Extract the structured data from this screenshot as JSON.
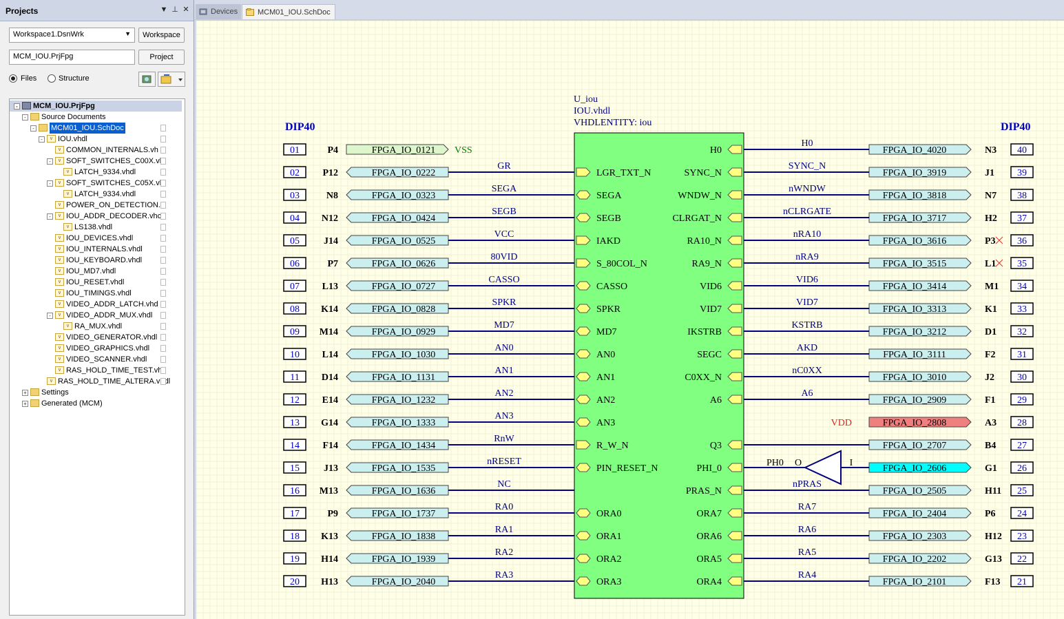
{
  "panel": {
    "title": "Projects",
    "workspace_combo": "Workspace1.DsnWrk",
    "workspace_button": "Workspace",
    "project_field": "MCM_IOU.PrjFpg",
    "project_button": "Project",
    "radio_files": "Files",
    "radio_structure": "Structure",
    "selected_view": "Files"
  },
  "tree": [
    {
      "label": "MCM_IOU.PrjFpg",
      "level": 0,
      "icon": "project",
      "expand": "-",
      "bold": true
    },
    {
      "label": "Source Documents",
      "level": 1,
      "icon": "folder",
      "expand": "-"
    },
    {
      "label": "MCM01_IOU.SchDoc",
      "level": 2,
      "icon": "folder",
      "expand": "-",
      "selected": true,
      "doc": true
    },
    {
      "label": "IOU.vhdl",
      "level": 3,
      "icon": "vhdl",
      "expand": "-",
      "doc": true
    },
    {
      "label": "COMMON_INTERNALS.vh",
      "level": 4,
      "icon": "vhdl",
      "doc": true
    },
    {
      "label": "SOFT_SWITCHES_C00X.vh",
      "level": 4,
      "icon": "vhdl",
      "expand": "-",
      "doc": true
    },
    {
      "label": "LATCH_9334.vhdl",
      "level": 5,
      "icon": "vhdl",
      "doc": true
    },
    {
      "label": "SOFT_SWITCHES_C05X.vh",
      "level": 4,
      "icon": "vhdl",
      "expand": "-",
      "doc": true
    },
    {
      "label": "LATCH_9334.vhdl",
      "level": 5,
      "icon": "vhdl",
      "doc": true
    },
    {
      "label": "POWER_ON_DETECTION.",
      "level": 4,
      "icon": "vhdl",
      "doc": true
    },
    {
      "label": "IOU_ADDR_DECODER.vhc",
      "level": 4,
      "icon": "vhdl",
      "expand": "-",
      "doc": true
    },
    {
      "label": "LS138.vhdl",
      "level": 5,
      "icon": "vhdl",
      "doc": true
    },
    {
      "label": "IOU_DEVICES.vhdl",
      "level": 4,
      "icon": "vhdl",
      "doc": true
    },
    {
      "label": "IOU_INTERNALS.vhdl",
      "level": 4,
      "icon": "vhdl",
      "doc": true
    },
    {
      "label": "IOU_KEYBOARD.vhdl",
      "level": 4,
      "icon": "vhdl",
      "doc": true
    },
    {
      "label": "IOU_MD7.vhdl",
      "level": 4,
      "icon": "vhdl",
      "doc": true
    },
    {
      "label": "IOU_RESET.vhdl",
      "level": 4,
      "icon": "vhdl",
      "doc": true
    },
    {
      "label": "IOU_TIMINGS.vhdl",
      "level": 4,
      "icon": "vhdl",
      "doc": true
    },
    {
      "label": "VIDEO_ADDR_LATCH.vhd",
      "level": 4,
      "icon": "vhdl",
      "doc": true
    },
    {
      "label": "VIDEO_ADDR_MUX.vhdl",
      "level": 4,
      "icon": "vhdl",
      "expand": "-",
      "doc": true
    },
    {
      "label": "RA_MUX.vhdl",
      "level": 5,
      "icon": "vhdl",
      "doc": true
    },
    {
      "label": "VIDEO_GENERATOR.vhdl",
      "level": 4,
      "icon": "vhdl",
      "doc": true
    },
    {
      "label": "VIDEO_GRAPHICS.vhdl",
      "level": 4,
      "icon": "vhdl",
      "doc": true
    },
    {
      "label": "VIDEO_SCANNER.vhdl",
      "level": 4,
      "icon": "vhdl",
      "doc": true
    },
    {
      "label": "RAS_HOLD_TIME_TEST.vh",
      "level": 4,
      "icon": "vhdl",
      "doc": true
    },
    {
      "label": "RAS_HOLD_TIME_ALTERA.vhdl",
      "level": 3,
      "icon": "vhdl",
      "doc": true
    },
    {
      "label": "Settings",
      "level": 1,
      "icon": "folder",
      "expand": "+"
    },
    {
      "label": "Generated (MCM)",
      "level": 1,
      "icon": "folder",
      "expand": "+"
    }
  ],
  "tabs": [
    {
      "label": "Devices",
      "active": false
    },
    {
      "label": "MCM01_IOU.SchDoc",
      "active": true
    }
  ],
  "schematic": {
    "component": {
      "designator": "U_iou",
      "file": "IOU.vhdl",
      "entity": "VHDLENTITY: iou"
    },
    "left_header": "DIP40",
    "right_header": "DIP40",
    "vss_label": "VSS",
    "vdd_label": "VDD",
    "buffer_in": "I",
    "buffer_out": "O",
    "colors": {
      "body": "#80ff80",
      "port": "#cbeeee",
      "port_cyan": "#00ffff",
      "port_vdd": "#f08080",
      "port_vss": "#ddf6cc",
      "wire": "#000080",
      "header": "#0000c0",
      "netlabel": "#000080",
      "pin_fill": "#ffff80"
    },
    "left_rows": [
      {
        "num": "01",
        "pin": "P4",
        "port": "FPGA_IO_0121",
        "net": "",
        "comp_pin": "",
        "dir": "out"
      },
      {
        "num": "02",
        "pin": "P12",
        "port": "FPGA_IO_0222",
        "net": "GR",
        "comp_pin": "LGR_TXT_N",
        "dir": "in"
      },
      {
        "num": "03",
        "pin": "N8",
        "port": "FPGA_IO_0323",
        "net": "SEGA",
        "comp_pin": "SEGA",
        "dir": "bi"
      },
      {
        "num": "04",
        "pin": "N12",
        "port": "FPGA_IO_0424",
        "net": "SEGB",
        "comp_pin": "SEGB",
        "dir": "bi"
      },
      {
        "num": "05",
        "pin": "J14",
        "port": "FPGA_IO_0525",
        "net": "VCC",
        "comp_pin": "IAKD",
        "dir": "in"
      },
      {
        "num": "06",
        "pin": "P7",
        "port": "FPGA_IO_0626",
        "net": "80VID",
        "comp_pin": "S_80COL_N",
        "dir": "in"
      },
      {
        "num": "07",
        "pin": "L13",
        "port": "FPGA_IO_0727",
        "net": "CASSO",
        "comp_pin": "CASSO",
        "dir": "bi"
      },
      {
        "num": "08",
        "pin": "K14",
        "port": "FPGA_IO_0828",
        "net": "SPKR",
        "comp_pin": "SPKR",
        "dir": "bi"
      },
      {
        "num": "09",
        "pin": "M14",
        "port": "FPGA_IO_0929",
        "net": "MD7",
        "comp_pin": "MD7",
        "dir": "bi"
      },
      {
        "num": "10",
        "pin": "L14",
        "port": "FPGA_IO_1030",
        "net": "AN0",
        "comp_pin": "AN0",
        "dir": "bi"
      },
      {
        "num": "11",
        "pin": "D14",
        "port": "FPGA_IO_1131",
        "net": "AN1",
        "comp_pin": "AN1",
        "dir": "bi"
      },
      {
        "num": "12",
        "pin": "E14",
        "port": "FPGA_IO_1232",
        "net": "AN2",
        "comp_pin": "AN2",
        "dir": "bi"
      },
      {
        "num": "13",
        "pin": "G14",
        "port": "FPGA_IO_1333",
        "net": "AN3",
        "comp_pin": "AN3",
        "dir": "bi"
      },
      {
        "num": "14",
        "pin": "F14",
        "port": "FPGA_IO_1434",
        "net": "RnW",
        "comp_pin": "R_W_N",
        "dir": "in"
      },
      {
        "num": "15",
        "pin": "J13",
        "port": "FPGA_IO_1535",
        "net": "nRESET",
        "comp_pin": "PIN_RESET_N",
        "dir": "io"
      },
      {
        "num": "16",
        "pin": "M13",
        "port": "FPGA_IO_1636",
        "net": "NC",
        "comp_pin": "",
        "dir": "none"
      },
      {
        "num": "17",
        "pin": "P9",
        "port": "FPGA_IO_1737",
        "net": "RA0",
        "comp_pin": "ORA0",
        "dir": "bi"
      },
      {
        "num": "18",
        "pin": "K13",
        "port": "FPGA_IO_1838",
        "net": "RA1",
        "comp_pin": "ORA1",
        "dir": "bi"
      },
      {
        "num": "19",
        "pin": "H14",
        "port": "FPGA_IO_1939",
        "net": "RA2",
        "comp_pin": "ORA2",
        "dir": "bi"
      },
      {
        "num": "20",
        "pin": "H13",
        "port": "FPGA_IO_2040",
        "net": "RA3",
        "comp_pin": "ORA3",
        "dir": "bi"
      }
    ],
    "right_rows": [
      {
        "num": "40",
        "pin": "N3",
        "port": "FPGA_IO_4020",
        "net": "H0",
        "comp_pin": "H0",
        "dir": "out",
        "nc": false
      },
      {
        "num": "39",
        "pin": "J1",
        "port": "FPGA_IO_3919",
        "net": "SYNC_N",
        "comp_pin": "SYNC_N",
        "dir": "out",
        "nc": false
      },
      {
        "num": "38",
        "pin": "N7",
        "port": "FPGA_IO_3818",
        "net": "nWNDW",
        "comp_pin": "WNDW_N",
        "dir": "out",
        "nc": false
      },
      {
        "num": "37",
        "pin": "H2",
        "port": "FPGA_IO_3717",
        "net": "nCLRGATE",
        "comp_pin": "CLRGAT_N",
        "dir": "out",
        "nc": false
      },
      {
        "num": "36",
        "pin": "P3",
        "port": "FPGA_IO_3616",
        "net": "nRA10",
        "comp_pin": "RA10_N",
        "dir": "out",
        "nc": true
      },
      {
        "num": "35",
        "pin": "L1",
        "port": "FPGA_IO_3515",
        "net": "nRA9",
        "comp_pin": "RA9_N",
        "dir": "out",
        "nc": true
      },
      {
        "num": "34",
        "pin": "M1",
        "port": "FPGA_IO_3414",
        "net": "VID6",
        "comp_pin": "VID6",
        "dir": "out",
        "nc": false
      },
      {
        "num": "33",
        "pin": "K1",
        "port": "FPGA_IO_3313",
        "net": "VID7",
        "comp_pin": "VID7",
        "dir": "out",
        "nc": false
      },
      {
        "num": "32",
        "pin": "D1",
        "port": "FPGA_IO_3212",
        "net": "KSTRB",
        "comp_pin": "IKSTRB",
        "dir": "out",
        "nc": false
      },
      {
        "num": "31",
        "pin": "F2",
        "port": "FPGA_IO_3111",
        "net": "AKD",
        "comp_pin": "SEGC",
        "dir": "out",
        "nc": false
      },
      {
        "num": "30",
        "pin": "J2",
        "port": "FPGA_IO_3010",
        "net": "nC0XX",
        "comp_pin": "C0XX_N",
        "dir": "out",
        "nc": false
      },
      {
        "num": "29",
        "pin": "F1",
        "port": "FPGA_IO_2909",
        "net": "A6",
        "comp_pin": "A6",
        "dir": "out",
        "nc": false
      },
      {
        "num": "28",
        "pin": "A3",
        "port": "FPGA_IO_2808",
        "net": "",
        "comp_pin": "",
        "dir": "vdd",
        "nc": false
      },
      {
        "num": "27",
        "pin": "B4",
        "port": "FPGA_IO_2707",
        "net": "",
        "comp_pin": "Q3",
        "dir": "out",
        "nc": false
      },
      {
        "num": "26",
        "pin": "G1",
        "port": "FPGA_IO_2606",
        "net": "PH0",
        "comp_pin": "PHI_0",
        "dir": "buf",
        "nc": false
      },
      {
        "num": "25",
        "pin": "H11",
        "port": "FPGA_IO_2505",
        "net": "nPRAS",
        "comp_pin": "PRAS_N",
        "dir": "out",
        "nc": false
      },
      {
        "num": "24",
        "pin": "P6",
        "port": "FPGA_IO_2404",
        "net": "RA7",
        "comp_pin": "ORA7",
        "dir": "out",
        "nc": false
      },
      {
        "num": "23",
        "pin": "H12",
        "port": "FPGA_IO_2303",
        "net": "RA6",
        "comp_pin": "ORA6",
        "dir": "out",
        "nc": false
      },
      {
        "num": "22",
        "pin": "G13",
        "port": "FPGA_IO_2202",
        "net": "RA5",
        "comp_pin": "ORA5",
        "dir": "out",
        "nc": false
      },
      {
        "num": "21",
        "pin": "F13",
        "port": "FPGA_IO_2101",
        "net": "RA4",
        "comp_pin": "ORA4",
        "dir": "out",
        "nc": false
      }
    ]
  }
}
